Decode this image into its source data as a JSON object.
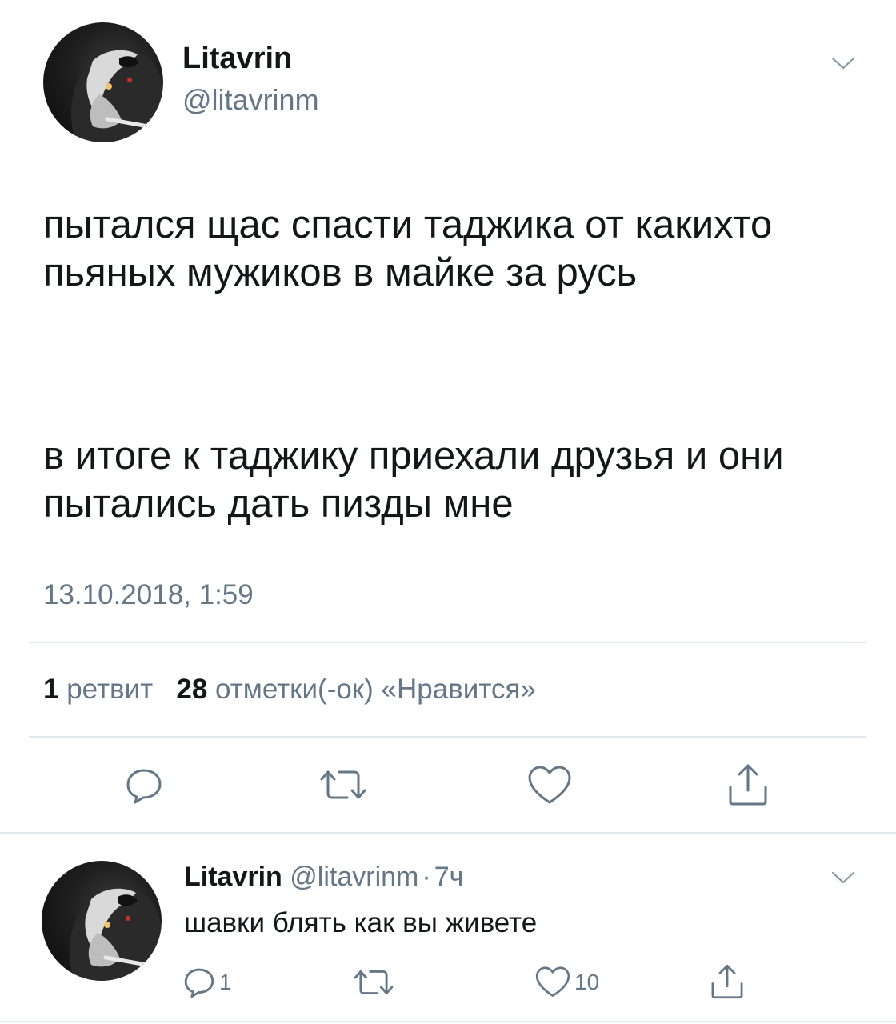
{
  "main_tweet": {
    "author_name": "Litavrin",
    "author_handle": "@litavrinm",
    "paragraph_1": "пытался щас спасти таджика от какихто пьяных мужиков в майке за русь",
    "paragraph_2": "в итоге к таджику приехали друзья и они пытались дать пизды мне",
    "timestamp": "13.10.2018, 1:59",
    "stats": {
      "retweets_count": "1",
      "retweets_label": "ретвит",
      "likes_count": "28",
      "likes_label": "отметки(-ок) «Нравится»"
    },
    "avatar_icon": "dog-avatar-icon",
    "menu_icon": "chevron-down-icon"
  },
  "actions": {
    "reply_icon": "reply-icon",
    "retweet_icon": "retweet-icon",
    "like_icon": "heart-icon",
    "share_icon": "share-icon"
  },
  "reply_tweet": {
    "author_name": "Litavrin",
    "author_handle": "@litavrinm",
    "separator": "·",
    "time_ago": "7ч",
    "text": "шавки блять как вы живете",
    "reply_count": "1",
    "like_count": "10"
  },
  "colors": {
    "text": "#14171a",
    "secondary": "#657786",
    "divider": "#e1e8ed"
  }
}
